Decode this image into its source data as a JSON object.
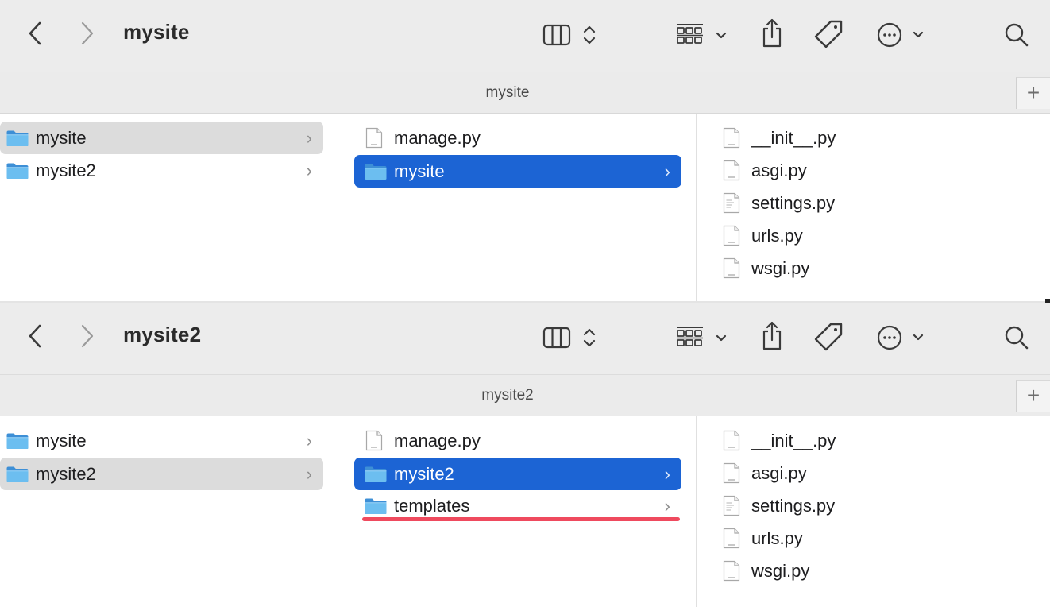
{
  "windows": [
    {
      "title": "mysite",
      "tab_title": "mysite",
      "plus_label": "+",
      "columns": [
        {
          "items": [
            {
              "label": "mysite",
              "kind": "folder",
              "state": "selected-inactive",
              "chevron": "›"
            },
            {
              "label": "mysite2",
              "kind": "folder",
              "state": "normal",
              "chevron": "›"
            }
          ]
        },
        {
          "items": [
            {
              "label": "manage.py",
              "kind": "file",
              "state": "normal",
              "chevron": ""
            },
            {
              "label": "mysite",
              "kind": "folder",
              "state": "selected-active",
              "chevron": "›"
            }
          ]
        },
        {
          "items": [
            {
              "label": "__init__.py",
              "kind": "file",
              "state": "normal",
              "chevron": ""
            },
            {
              "label": "asgi.py",
              "kind": "file",
              "state": "normal",
              "chevron": ""
            },
            {
              "label": "settings.py",
              "kind": "file-text",
              "state": "normal",
              "chevron": ""
            },
            {
              "label": "urls.py",
              "kind": "file",
              "state": "normal",
              "chevron": ""
            },
            {
              "label": "wsgi.py",
              "kind": "file",
              "state": "normal",
              "chevron": ""
            }
          ]
        }
      ]
    },
    {
      "title": "mysite2",
      "tab_title": "mysite2",
      "plus_label": "+",
      "columns": [
        {
          "items": [
            {
              "label": "mysite",
              "kind": "folder",
              "state": "normal",
              "chevron": "›"
            },
            {
              "label": "mysite2",
              "kind": "folder",
              "state": "selected-inactive",
              "chevron": "›"
            }
          ]
        },
        {
          "items": [
            {
              "label": "manage.py",
              "kind": "file",
              "state": "normal",
              "chevron": ""
            },
            {
              "label": "mysite2",
              "kind": "folder",
              "state": "selected-active",
              "chevron": "›"
            },
            {
              "label": "templates",
              "kind": "folder",
              "state": "highlighted-underline",
              "chevron": "›"
            }
          ]
        },
        {
          "items": [
            {
              "label": "__init__.py",
              "kind": "file",
              "state": "normal",
              "chevron": ""
            },
            {
              "label": "asgi.py",
              "kind": "file",
              "state": "normal",
              "chevron": ""
            },
            {
              "label": "settings.py",
              "kind": "file-text",
              "state": "normal",
              "chevron": ""
            },
            {
              "label": "urls.py",
              "kind": "file",
              "state": "normal",
              "chevron": ""
            },
            {
              "label": "wsgi.py",
              "kind": "file",
              "state": "normal",
              "chevron": ""
            }
          ]
        }
      ]
    }
  ],
  "toolbar_icons": [
    "back-icon",
    "forward-icon",
    "column-view-icon",
    "group-icon",
    "share-icon",
    "tag-icon",
    "more-icon",
    "search-icon"
  ],
  "colors": {
    "toolbar_bg": "#ececec",
    "selection_blue": "#1c64d4",
    "selection_gray": "#dcdcdc",
    "folder_blue": "#5aaee8",
    "underline_red": "#ef4a5e"
  }
}
